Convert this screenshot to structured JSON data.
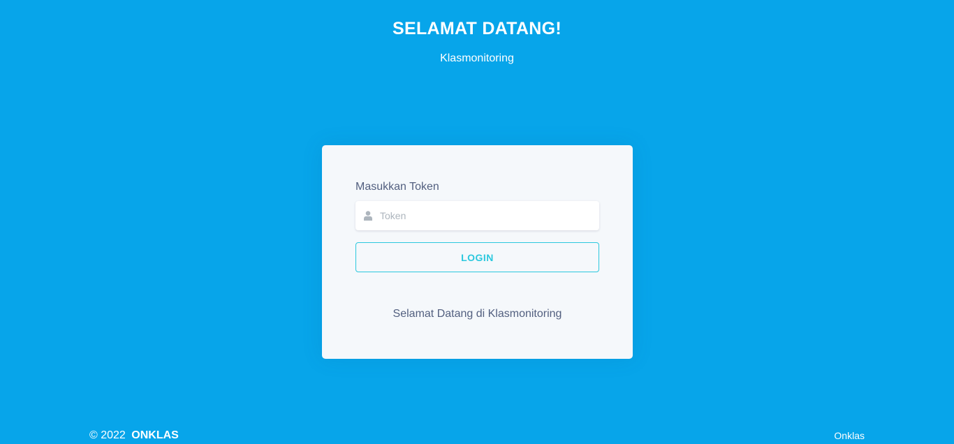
{
  "header": {
    "title": "SELAMAT DATANG!",
    "subtitle": "Klasmonitoring"
  },
  "login_card": {
    "field_label": "Masukkan Token",
    "token_input": {
      "value": "",
      "placeholder": "Token",
      "icon": "user-icon"
    },
    "login_button_label": "LOGIN",
    "welcome_text": "Selamat Datang di Klasmonitoring"
  },
  "footer": {
    "copyright": "© 2022",
    "brand": "ONKLAS",
    "link": "Onklas"
  },
  "colors": {
    "background": "#07a5ea",
    "card": "#f5f8fb",
    "accent": "#2bc8de",
    "text": "#525f7f"
  }
}
